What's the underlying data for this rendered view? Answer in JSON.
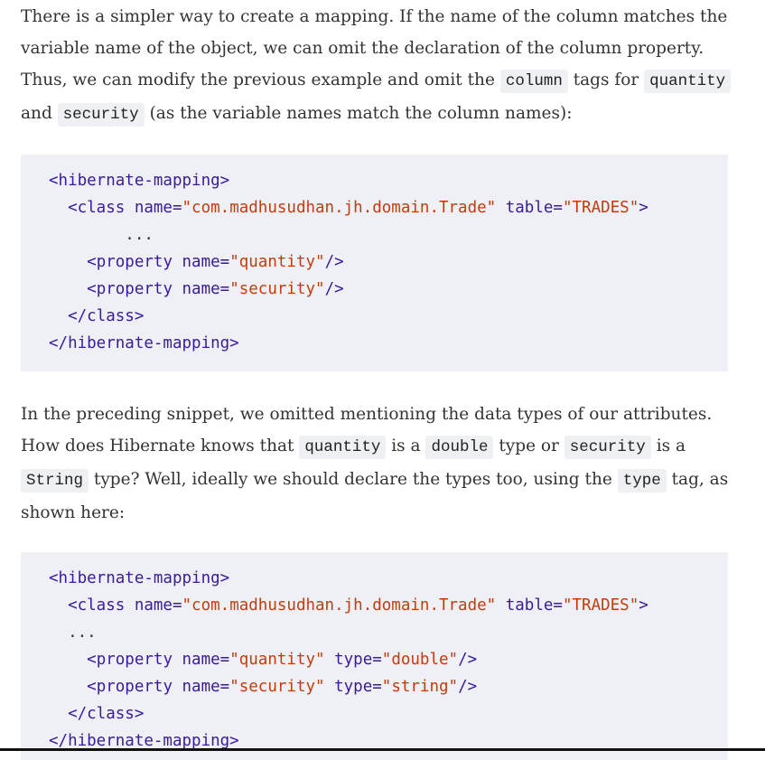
{
  "paragraph1": [
    {
      "type": "text",
      "v": "There is a simpler way to create a mapping. If the name of the column matches the variable name of the object, we can omit the declaration of the column property. Thus, we can modify the previous example and omit the "
    },
    {
      "type": "code",
      "v": "column"
    },
    {
      "type": "text",
      "v": " tags for "
    },
    {
      "type": "code",
      "v": "quantity"
    },
    {
      "type": "text",
      "v": " and "
    },
    {
      "type": "code",
      "v": "security"
    },
    {
      "type": "text",
      "v": " (as the variable names match the column names):"
    }
  ],
  "code1": [
    [
      {
        "c": "tag",
        "v": "<hibernate-mapping>"
      }
    ],
    [
      {
        "c": "plain",
        "v": "  "
      },
      {
        "c": "tag",
        "v": "<class name="
      },
      {
        "c": "str",
        "v": "\"com.madhusudhan.jh.domain.Trade\""
      },
      {
        "c": "tag",
        "v": " table="
      },
      {
        "c": "str",
        "v": "\"TRADES\""
      },
      {
        "c": "tag",
        "v": ">"
      }
    ],
    [
      {
        "c": "plain",
        "v": "        ..."
      }
    ],
    [
      {
        "c": "plain",
        "v": "    "
      },
      {
        "c": "tag",
        "v": "<property name="
      },
      {
        "c": "str",
        "v": "\"quantity\""
      },
      {
        "c": "tag",
        "v": "/>"
      }
    ],
    [
      {
        "c": "plain",
        "v": "    "
      },
      {
        "c": "tag",
        "v": "<property name="
      },
      {
        "c": "str",
        "v": "\"security\""
      },
      {
        "c": "tag",
        "v": "/>"
      }
    ],
    [
      {
        "c": "plain",
        "v": "  "
      },
      {
        "c": "tag",
        "v": "</class>"
      }
    ],
    [
      {
        "c": "tag",
        "v": "</hibernate-mapping>"
      }
    ]
  ],
  "paragraph2": [
    {
      "type": "text",
      "v": "In the preceding snippet, we omitted mentioning the data types of our attributes. How does Hibernate knows that "
    },
    {
      "type": "code",
      "v": "quantity"
    },
    {
      "type": "text",
      "v": " is a "
    },
    {
      "type": "code",
      "v": "double"
    },
    {
      "type": "text",
      "v": " type or "
    },
    {
      "type": "code",
      "v": "security"
    },
    {
      "type": "text",
      "v": " is a "
    },
    {
      "type": "code",
      "v": "String"
    },
    {
      "type": "text",
      "v": " type? Well, ideally we should declare the types too, using the "
    },
    {
      "type": "code",
      "v": "type"
    },
    {
      "type": "text",
      "v": " tag, as shown here:"
    }
  ],
  "code2": [
    [
      {
        "c": "tag",
        "v": "<hibernate-mapping>"
      }
    ],
    [
      {
        "c": "plain",
        "v": "  "
      },
      {
        "c": "tag",
        "v": "<class name="
      },
      {
        "c": "str",
        "v": "\"com.madhusudhan.jh.domain.Trade\""
      },
      {
        "c": "tag",
        "v": " table="
      },
      {
        "c": "str",
        "v": "\"TRADES\""
      },
      {
        "c": "tag",
        "v": ">"
      }
    ],
    [
      {
        "c": "plain",
        "v": "  ..."
      }
    ],
    [
      {
        "c": "plain",
        "v": "    "
      },
      {
        "c": "tag",
        "v": "<property name="
      },
      {
        "c": "str",
        "v": "\"quantity\""
      },
      {
        "c": "tag",
        "v": " type="
      },
      {
        "c": "str",
        "v": "\"double\""
      },
      {
        "c": "tag",
        "v": "/>"
      }
    ],
    [
      {
        "c": "plain",
        "v": "    "
      },
      {
        "c": "tag",
        "v": "<property name="
      },
      {
        "c": "str",
        "v": "\"security\""
      },
      {
        "c": "tag",
        "v": " type="
      },
      {
        "c": "str",
        "v": "\"string\""
      },
      {
        "c": "tag",
        "v": "/>"
      }
    ],
    [
      {
        "c": "plain",
        "v": "  "
      },
      {
        "c": "tag",
        "v": "</class>"
      }
    ],
    [
      {
        "c": "tag",
        "v": "</hibernate-mapping>"
      }
    ]
  ]
}
